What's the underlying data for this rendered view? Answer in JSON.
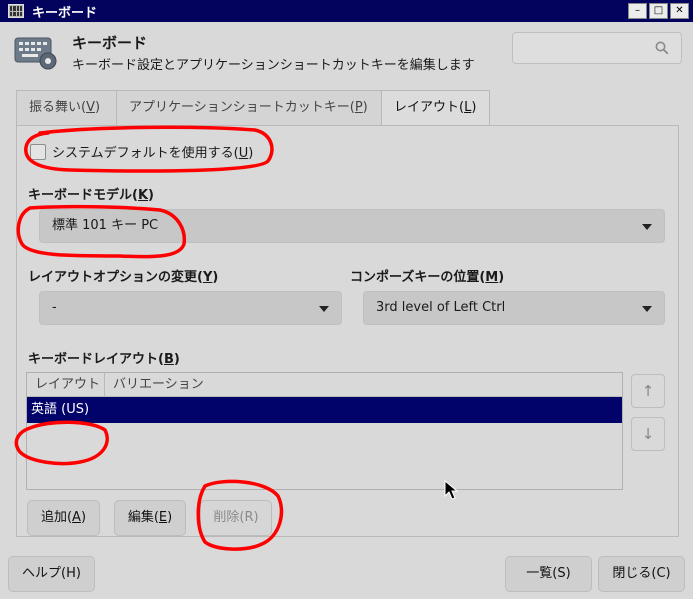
{
  "window": {
    "title": "キーボード",
    "buttons": {
      "minimize": "–",
      "maximize": "□",
      "close": "✕"
    }
  },
  "header": {
    "title": "キーボード",
    "subtitle": "キーボード設定とアプリケーションショートカットキーを編集します",
    "search_placeholder": ""
  },
  "tabs": [
    {
      "label": "振る舞い(",
      "mnemonic": "V",
      "suffix": ")"
    },
    {
      "label": "アプリケーションショートカットキー(",
      "mnemonic": "P",
      "suffix": ")"
    },
    {
      "label": "レイアウト(",
      "mnemonic": "L",
      "suffix": ")",
      "active": true
    }
  ],
  "layout_tab": {
    "use_system_default": {
      "label": "システムデフォルトを使用する(",
      "mnemonic": "U",
      "suffix": ")",
      "checked": false
    },
    "keyboard_model": {
      "label": "キーボードモデル(",
      "mnemonic": "K",
      "suffix": ")",
      "value": "標準 101 キー PC"
    },
    "layout_option": {
      "label": "レイアウトオプションの変更(",
      "mnemonic": "Y",
      "suffix": ")",
      "value": "-"
    },
    "compose_key": {
      "label": "コンポーズキーの位置(",
      "mnemonic": "M",
      "suffix": ")",
      "value": "3rd level of Left Ctrl"
    },
    "keyboard_layout": {
      "label": "キーボードレイアウト(",
      "mnemonic": "B",
      "suffix": ")",
      "columns": [
        "レイアウト",
        "バリエーション"
      ],
      "rows": [
        {
          "layout": "英語 (US)",
          "variation": "",
          "selected": true
        }
      ],
      "up_label": "↑",
      "down_label": "↓"
    },
    "buttons": {
      "add": {
        "label": "追加(",
        "mnemonic": "A",
        "suffix": ")"
      },
      "edit": {
        "label": "編集(",
        "mnemonic": "E",
        "suffix": ")"
      },
      "delete": {
        "label": "削除(R)",
        "disabled": true
      }
    }
  },
  "footer": {
    "help": "ヘルプ(H)",
    "list": "一覧(S)",
    "close": "閉じる(C)"
  },
  "colors": {
    "titlebar": "#03035e",
    "selection": "#02026b",
    "annotation": "#ff0000"
  }
}
